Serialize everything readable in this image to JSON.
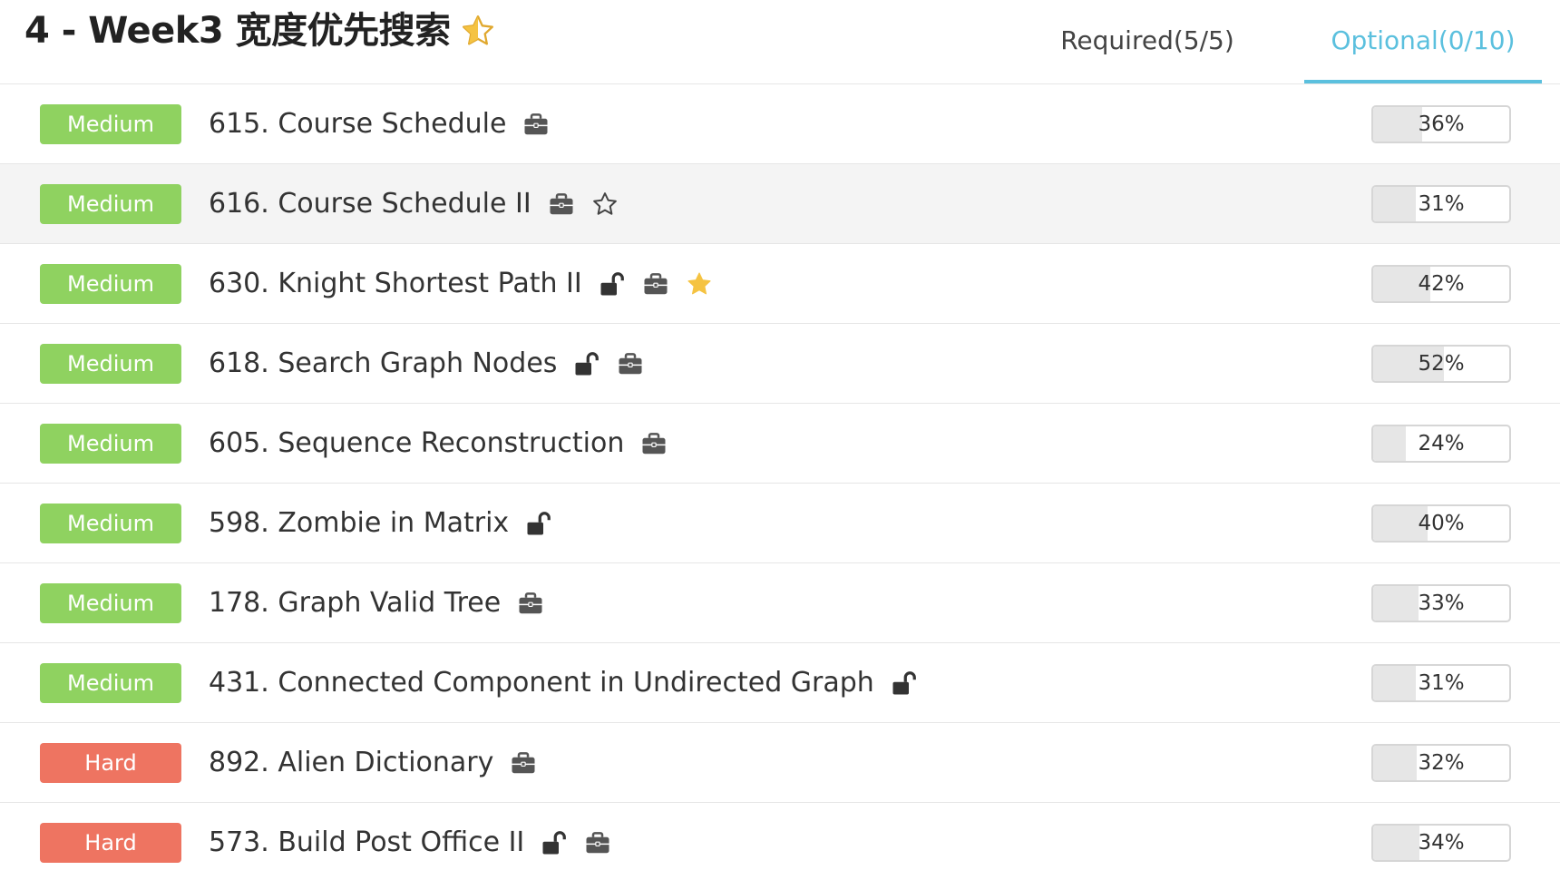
{
  "header": {
    "title": "4 - Week3 宽度优先搜索",
    "tabs": {
      "required": "Required(5/5)",
      "optional": "Optional(0/10)"
    }
  },
  "colors": {
    "medium": "#8fd260",
    "hard": "#ee7461",
    "active_tab": "#5bc0de",
    "star": "#f5c342"
  },
  "problems": [
    {
      "difficulty": "Medium",
      "title": "615. Course Schedule",
      "icons": [
        "briefcase-icon"
      ],
      "rate": "36%",
      "rate_value": 36
    },
    {
      "difficulty": "Medium",
      "title": "616. Course Schedule II",
      "icons": [
        "briefcase-icon",
        "star-outline-icon"
      ],
      "rate": "31%",
      "rate_value": 31
    },
    {
      "difficulty": "Medium",
      "title": "630. Knight Shortest Path II",
      "icons": [
        "unlock-icon",
        "briefcase-icon",
        "star-filled-icon"
      ],
      "rate": "42%",
      "rate_value": 42
    },
    {
      "difficulty": "Medium",
      "title": "618. Search Graph Nodes",
      "icons": [
        "unlock-icon",
        "briefcase-icon"
      ],
      "rate": "52%",
      "rate_value": 52
    },
    {
      "difficulty": "Medium",
      "title": "605. Sequence Reconstruction",
      "icons": [
        "briefcase-icon"
      ],
      "rate": "24%",
      "rate_value": 24
    },
    {
      "difficulty": "Medium",
      "title": "598. Zombie in Matrix",
      "icons": [
        "unlock-icon"
      ],
      "rate": "40%",
      "rate_value": 40
    },
    {
      "difficulty": "Medium",
      "title": "178. Graph Valid Tree",
      "icons": [
        "briefcase-icon"
      ],
      "rate": "33%",
      "rate_value": 33
    },
    {
      "difficulty": "Medium",
      "title": "431. Connected Component in Undirected Graph",
      "icons": [
        "unlock-icon"
      ],
      "rate": "31%",
      "rate_value": 31
    },
    {
      "difficulty": "Hard",
      "title": "892. Alien Dictionary",
      "icons": [
        "briefcase-icon"
      ],
      "rate": "32%",
      "rate_value": 32
    },
    {
      "difficulty": "Hard",
      "title": "573. Build Post Office II",
      "icons": [
        "unlock-icon",
        "briefcase-icon"
      ],
      "rate": "34%",
      "rate_value": 34
    }
  ]
}
